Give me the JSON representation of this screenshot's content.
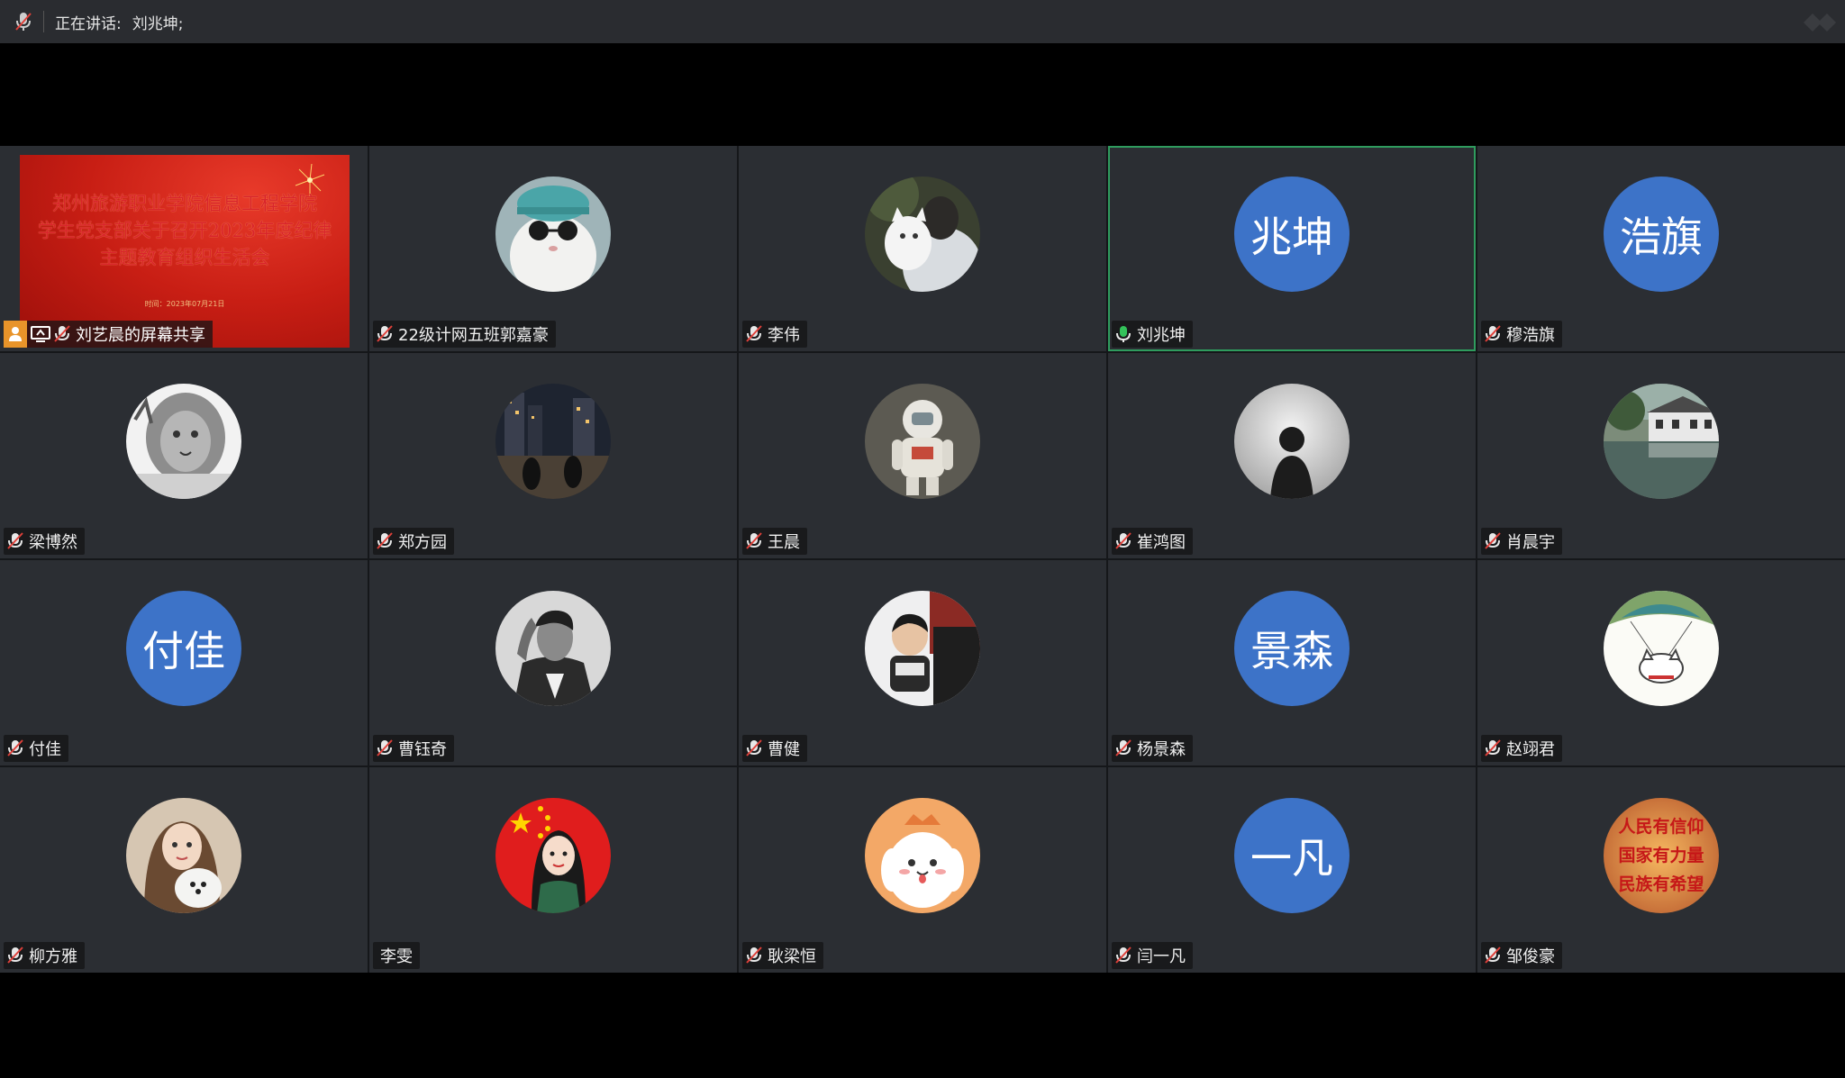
{
  "topbar": {
    "speaking_label": "正在讲话:",
    "speaking_name": "刘兆坤;"
  },
  "share": {
    "title_line1": "郑州旅游职业学院信息工程学院",
    "title_line2": "学生党支部关于召开2023年度纪律",
    "title_line3": "主题教育组织生活会",
    "date": "时间：2023年07月21日",
    "label": "刘艺晨的屏幕共享"
  },
  "participants": [
    {
      "name": "22级计网五班郭嘉豪",
      "avatar": "cat-with-cap"
    },
    {
      "name": "李伟",
      "avatar": "person-with-cat"
    },
    {
      "name": "刘兆坤",
      "initials": "兆坤",
      "speaking": true
    },
    {
      "name": "穆浩旗",
      "initials": "浩旗"
    },
    {
      "name": "梁博然",
      "avatar": "lion-statue"
    },
    {
      "name": "郑方园",
      "avatar": "night-city"
    },
    {
      "name": "王晨",
      "avatar": "astronaut"
    },
    {
      "name": "崔鸿图",
      "avatar": "silhouette"
    },
    {
      "name": "肖晨宇",
      "avatar": "canal-town"
    },
    {
      "name": "付佳",
      "initials": "付佳"
    },
    {
      "name": "曹钰奇",
      "avatar": "man-portrait"
    },
    {
      "name": "曹健",
      "avatar": "child"
    },
    {
      "name": "杨景森",
      "initials": "景森"
    },
    {
      "name": "赵翊君",
      "avatar": "cartoon-cat"
    },
    {
      "name": "柳方雅",
      "avatar": "girl-with-dog"
    },
    {
      "name": "李雯",
      "avatar": "girl-with-flag",
      "no_mic": true
    },
    {
      "name": "耿梁恒",
      "avatar": "cartoon-dog"
    },
    {
      "name": "闫一凡",
      "initials": "一凡"
    },
    {
      "name": "邹俊豪",
      "avatar": "slogan"
    }
  ],
  "slogan_text": [
    "人民有信仰",
    "国家有力量",
    "民族有希望"
  ],
  "colors": {
    "tile_bg": "#2b2e33",
    "initials_bg": "#3d73c8",
    "speaking_border": "#2f9c5e",
    "share_red": "#c81e14"
  }
}
